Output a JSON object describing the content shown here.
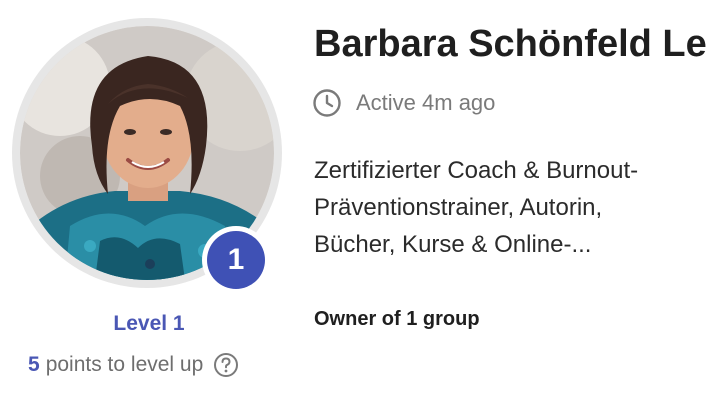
{
  "profile": {
    "name": "Barbara Schönfeld Leb",
    "active_status": "Active 4m ago",
    "bio_lines": [
      "Zertifizierter Coach & Burnout-",
      "Präventionstrainer, Autorin,",
      "Bücher, Kurse & Online-..."
    ],
    "owner_text": "Owner of 1 group",
    "avatar_icon": "profile-photo"
  },
  "level": {
    "badge_number": "1",
    "label": "Level 1",
    "points_to_next": "5",
    "points_suffix": "points to level up",
    "help_icon": "question-circle-icon"
  },
  "colors": {
    "accent": "#3f51b5",
    "level_text": "#4a57b4",
    "muted_text": "#7a7a7a",
    "ring": "#e6e6e6"
  }
}
